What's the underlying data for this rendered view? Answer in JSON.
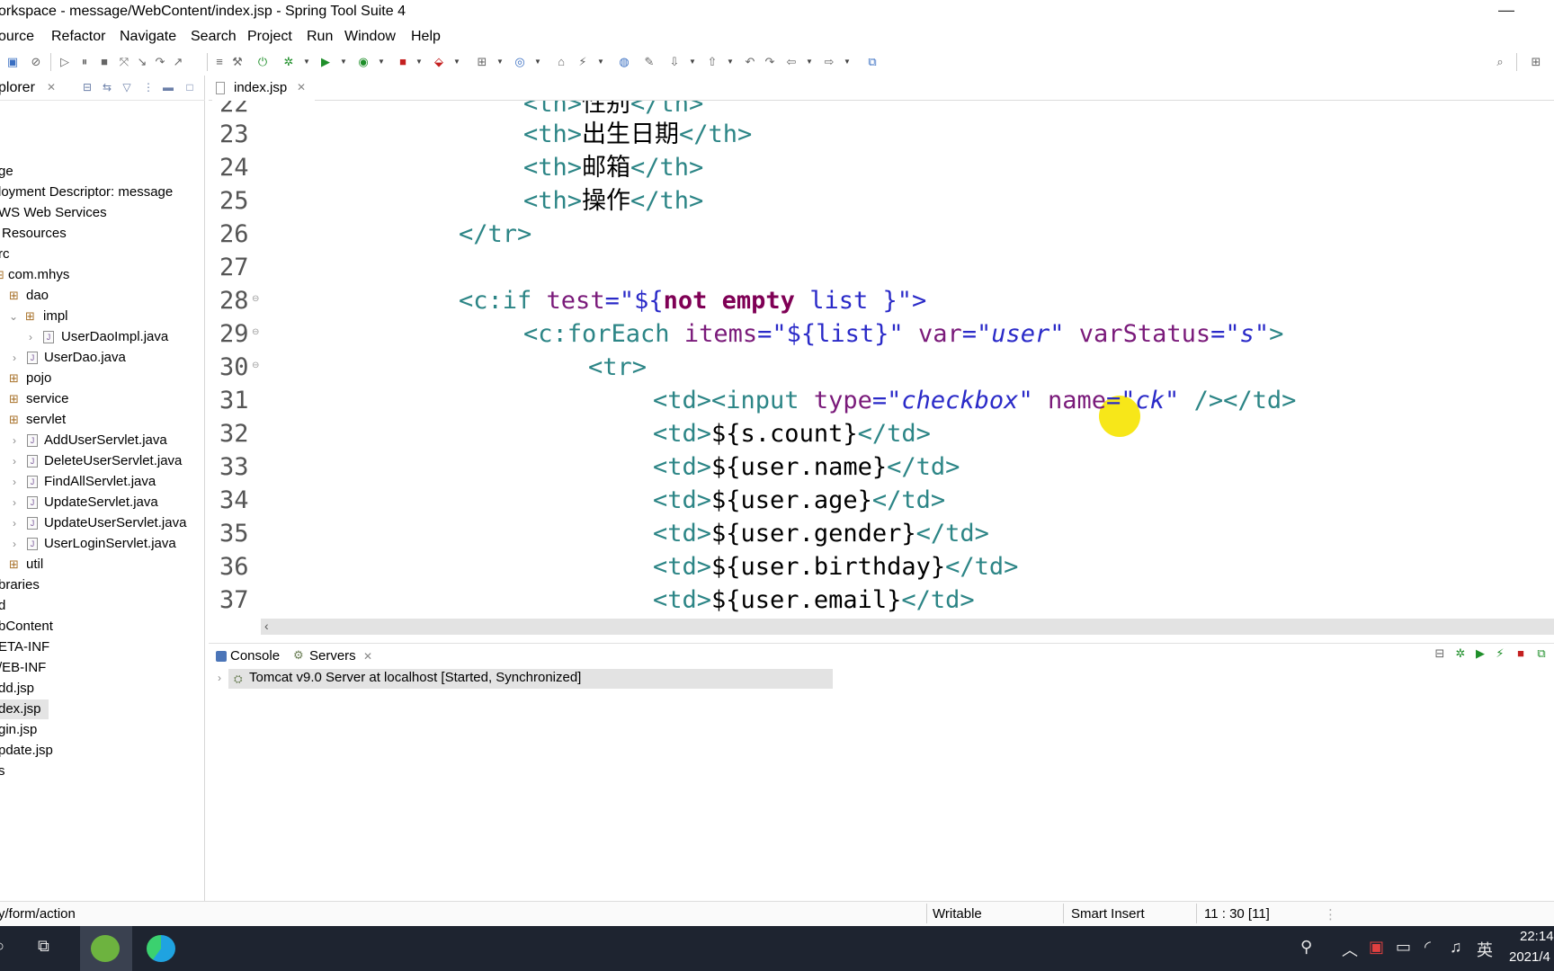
{
  "window": {
    "title": "orkspace - message/WebContent/index.jsp - Spring Tool Suite 4",
    "minimize_glyph": "—"
  },
  "menu": [
    "ource",
    "Refactor",
    "Navigate",
    "Search",
    "Project",
    "Run",
    "Window",
    "Help"
  ],
  "explorer": {
    "tab_label": "plorer",
    "items": [
      {
        "label": "ge",
        "icon": "none"
      },
      {
        "label": "loyment Descriptor: message",
        "icon": "none"
      },
      {
        "label": "WS Web Services",
        "icon": "none"
      },
      {
        "label": "Resources",
        "icon": "none"
      },
      {
        "label": "rc",
        "icon": "none"
      },
      {
        "label": "com.mhys",
        "icon": "package-icon"
      },
      {
        "label": "dao",
        "icon": "package-icon"
      },
      {
        "label": "impl",
        "icon": "package-icon"
      },
      {
        "label": "UserDaoImpl.java",
        "icon": "java-file-icon"
      },
      {
        "label": "UserDao.java",
        "icon": "java-file-icon"
      },
      {
        "label": "pojo",
        "icon": "package-icon"
      },
      {
        "label": "service",
        "icon": "package-icon"
      },
      {
        "label": "servlet",
        "icon": "package-icon"
      },
      {
        "label": "AddUserServlet.java",
        "icon": "java-file-icon"
      },
      {
        "label": "DeleteUserServlet.java",
        "icon": "java-file-icon"
      },
      {
        "label": "FindAllServlet.java",
        "icon": "java-file-icon"
      },
      {
        "label": "UpdateServlet.java",
        "icon": "java-file-icon"
      },
      {
        "label": "UpdateUserServlet.java",
        "icon": "java-file-icon"
      },
      {
        "label": "UserLoginServlet.java",
        "icon": "java-file-icon"
      },
      {
        "label": "util",
        "icon": "package-icon"
      },
      {
        "label": "braries",
        "icon": "none"
      },
      {
        "label": "d",
        "icon": "none"
      },
      {
        "label": "bContent",
        "icon": "none"
      },
      {
        "label": "ETA-INF",
        "icon": "none"
      },
      {
        "label": "/EB-INF",
        "icon": "none"
      },
      {
        "label": "dd.jsp",
        "icon": "none"
      },
      {
        "label": "dex.jsp",
        "icon": "none"
      },
      {
        "label": "gin.jsp",
        "icon": "none"
      },
      {
        "label": "pdate.jsp",
        "icon": "none"
      },
      {
        "label": "s",
        "icon": "none"
      }
    ]
  },
  "editor": {
    "tab_label": "index.jsp",
    "line_numbers": [
      "22",
      "23",
      "24",
      "25",
      "26",
      "27",
      "28",
      "29",
      "30",
      "31",
      "32",
      "33",
      "34",
      "35",
      "36",
      "37"
    ],
    "lines": {
      "l22": {
        "open": "<th>",
        "text": "性别",
        "close": "</th>"
      },
      "l23": {
        "open": "<th>",
        "text": "出生日期",
        "close": "</th>"
      },
      "l24": {
        "open": "<th>",
        "text": "邮箱",
        "close": "</th>"
      },
      "l25": {
        "open": "<th>",
        "text": "操作",
        "close": "</th>"
      },
      "l26": {
        "close": "</tr>"
      },
      "l28": {
        "tag": "<c:if",
        "attr": "test",
        "eq": "=\"${",
        "kw1": "not",
        "kw2": "empty",
        "rest": " list }\">"
      },
      "l29": {
        "tag": "<c:forEach",
        "attr1": "items",
        "val1": "=\"${list}\"",
        "attr2": "var",
        "val2": "\"user\"",
        "attr3": "varStatus",
        "val3": "\"s\"",
        "end": ">"
      },
      "l30": {
        "tag": "<tr>"
      },
      "l31": {
        "td": "<td>",
        "input": "<input",
        "attr1": "type",
        "val1": "\"checkbox\"",
        "attr2": "name",
        "val2": "\"ck\"",
        "end": "/>",
        "close": "</td>"
      },
      "l32": {
        "td": "<td>",
        "expr": "${s.count}",
        "close": "</td>"
      },
      "l33": {
        "td": "<td>",
        "expr": "${user.name}",
        "close": "</td>"
      },
      "l34": {
        "td": "<td>",
        "expr": "${user.age}",
        "close": "</td>"
      },
      "l35": {
        "td": "<td>",
        "expr": "${user.gender}",
        "close": "</td>"
      },
      "l36": {
        "td": "<td>",
        "expr": "${user.birthday}",
        "close": "</td>"
      },
      "l37": {
        "td": "<td>",
        "expr": "${user.email}",
        "close": "</td>"
      }
    }
  },
  "bottom": {
    "console_label": "Console",
    "servers_label": "Servers",
    "server_entry": "Tomcat v9.0 Server at localhost  [Started, Synchronized]"
  },
  "status": {
    "path": "y/form/action",
    "writable": "Writable",
    "insert_mode": "Smart Insert",
    "position": "11 : 30 [11]"
  },
  "taskbar": {
    "time": "22:14",
    "date": "2021/4",
    "ime": "英"
  }
}
